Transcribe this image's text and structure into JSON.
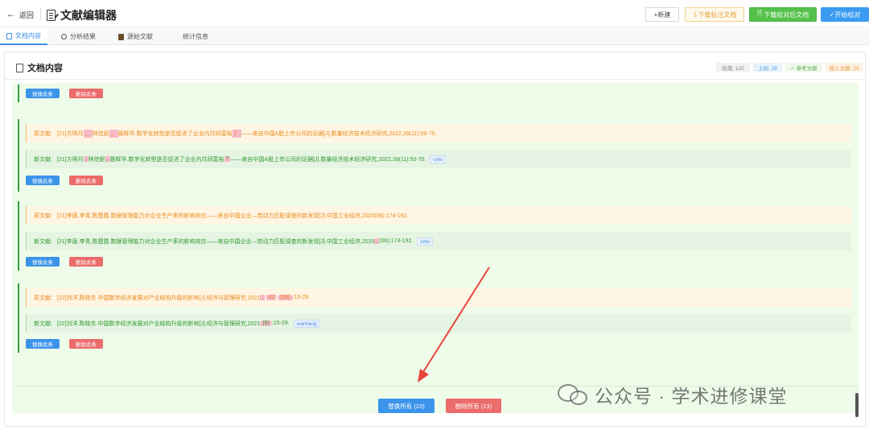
{
  "header": {
    "back_label": "返回",
    "app_title": "文献编辑器",
    "buttons": {
      "new": "+新建",
      "download_marked": "⇩下载标注文档",
      "download_proofread": "下载校对后文档",
      "start_proofread": "✓开始校对"
    }
  },
  "tabs": [
    {
      "label": "文档内容",
      "active": true
    },
    {
      "label": "分析结果",
      "active": false
    },
    {
      "label": "源始文献",
      "active": false
    },
    {
      "label": "统计信息",
      "active": false
    }
  ],
  "card": {
    "title": "文档内容",
    "stats": {
      "paragraphs": "段落: 125",
      "superscript": "上标: 28",
      "references": "✓ 参考文献",
      "inserted": "插入文献: 23"
    }
  },
  "row_labels": {
    "original": "原文献:",
    "new": "新文献:"
  },
  "action_labels": {
    "replace": "替换此条",
    "delete": "删除此条"
  },
  "entries": [
    {
      "original": {
        "p1": "[21]方明月",
        "h1": "，",
        "p2": "林佳妮",
        "h2": "，",
        "p3": "聂辉华.数字化转型是否促进了企业内共同富裕",
        "h3": "？",
        "p4": "——来自中国A股上市公司的证据[J].数量经济技术经济研究,2022,39(11):50-70."
      },
      "new": {
        "p1": "[21]方明月",
        "h1": ",",
        "p2": "林佳妮",
        "h2": ",",
        "p3": "聂辉华.数字化转型是否促进了企业内共同富裕",
        "h3": "?",
        "p4": "——来自中国A股上市公司的证据[J].数量经济技术经济研究,2022,39(11):50-70.",
        "source": "cnki"
      }
    },
    {
      "original": {
        "text": "[21]李唐,李青,陈楚霞.数据管理能力对企业生产率的影响效应——来自中国企业—劳动力匹配调查的新发现[J].中国工业经济,2020(06):174-192."
      },
      "new": {
        "p1": "[21]李唐,李青,陈楚霞.数据管理能力对企业生产率的影响效应——来自中国企业—劳动力匹配调查的新发现[J].中国工业经济,2020",
        "h1": ",",
        "p2": "(06):174-192.",
        "source": "cnki"
      }
    },
    {
      "original": {
        "p1": "[22]刘洋,陈晓东.中国数字经济发展对产业结构升级的影响[J].经济与管理研究,2021",
        "h1": ",",
        "h2": "42",
        "h3": "(08)",
        "p2": ":15-29."
      },
      "new": {
        "p1": "[22]刘洋,陈晓东.中国数字经济发展对产业结构升级的影响[J].经济与管理研究,2021",
        "h1": "(8)",
        "p2": ":15-29.",
        "source": "wanfang"
      }
    }
  ],
  "bottom": {
    "replace_all": "替换所有 (23)",
    "delete_all": "删除所有 (23)"
  },
  "watermark": "公众号 · 学术进修课堂",
  "colors": {
    "accent_blue": "#3c94ea",
    "danger_red": "#ec6b6b",
    "success_green": "#53c14a",
    "annotation_arrow": "#e8443a"
  }
}
